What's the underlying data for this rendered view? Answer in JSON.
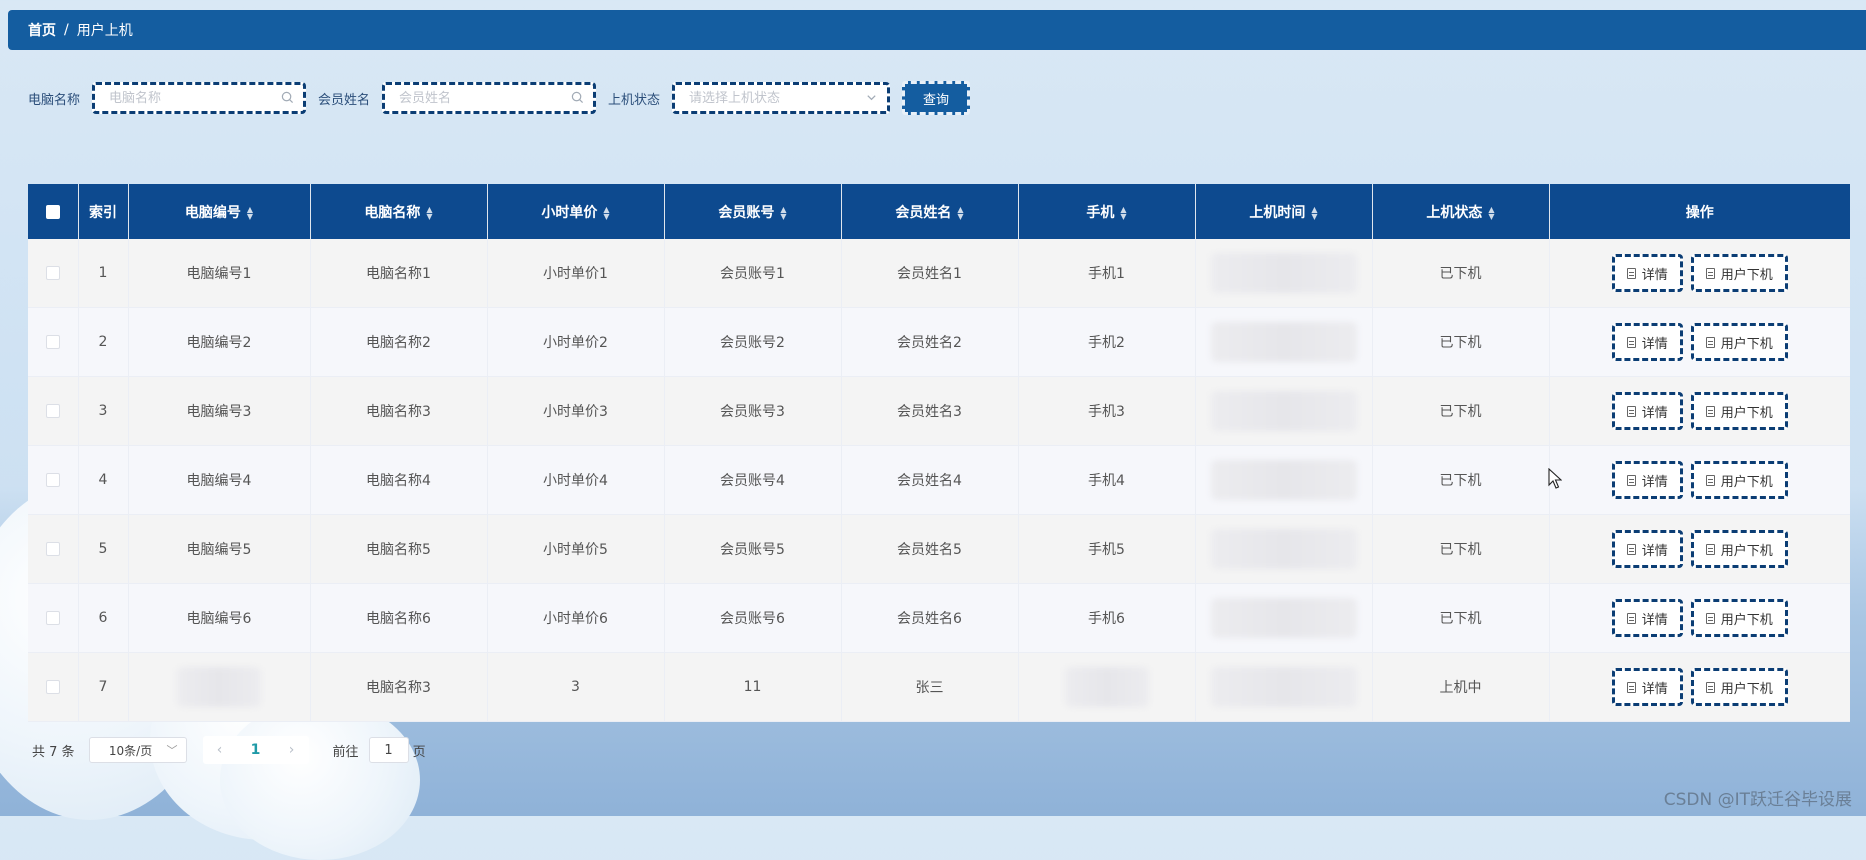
{
  "breadcrumb": {
    "home": "首页",
    "separator": "/",
    "current": "用户上机"
  },
  "search": {
    "computer_name": {
      "label": "电脑名称",
      "placeholder": "电脑名称",
      "value": ""
    },
    "member_name": {
      "label": "会员姓名",
      "placeholder": "会员姓名",
      "value": ""
    },
    "status": {
      "label": "上机状态",
      "placeholder": "请选择上机状态",
      "value": ""
    },
    "query_label": "查询"
  },
  "table": {
    "columns": [
      "索引",
      "电脑编号",
      "电脑名称",
      "小时单价",
      "会员账号",
      "会员姓名",
      "手机",
      "上机时间",
      "上机状态",
      "操作"
    ],
    "rows": [
      {
        "index": "1",
        "computer_no": "电脑编号1",
        "computer_name": "电脑名称1",
        "hour_price": "小时单价1",
        "member_account": "会员账号1",
        "member_name": "会员姓名1",
        "phone": "手机1",
        "status": "已下机"
      },
      {
        "index": "2",
        "computer_no": "电脑编号2",
        "computer_name": "电脑名称2",
        "hour_price": "小时单价2",
        "member_account": "会员账号2",
        "member_name": "会员姓名2",
        "phone": "手机2",
        "status": "已下机"
      },
      {
        "index": "3",
        "computer_no": "电脑编号3",
        "computer_name": "电脑名称3",
        "hour_price": "小时单价3",
        "member_account": "会员账号3",
        "member_name": "会员姓名3",
        "phone": "手机3",
        "status": "已下机"
      },
      {
        "index": "4",
        "computer_no": "电脑编号4",
        "computer_name": "电脑名称4",
        "hour_price": "小时单价4",
        "member_account": "会员账号4",
        "member_name": "会员姓名4",
        "phone": "手机4",
        "status": "已下机"
      },
      {
        "index": "5",
        "computer_no": "电脑编号5",
        "computer_name": "电脑名称5",
        "hour_price": "小时单价5",
        "member_account": "会员账号5",
        "member_name": "会员姓名5",
        "phone": "手机5",
        "status": "已下机"
      },
      {
        "index": "6",
        "computer_no": "电脑编号6",
        "computer_name": "电脑名称6",
        "hour_price": "小时单价6",
        "member_account": "会员账号6",
        "member_name": "会员姓名6",
        "phone": "手机6",
        "status": "已下机"
      },
      {
        "index": "7",
        "computer_no": "",
        "computer_name": "电脑名称3",
        "hour_price": "3",
        "member_account": "11",
        "member_name": "张三",
        "phone": "",
        "status": "上机中"
      }
    ],
    "actions": {
      "detail": "详情",
      "logout": "用户下机"
    }
  },
  "pagination": {
    "total_text": "共 7 条",
    "page_size": "10条/页",
    "current_page": "1",
    "goto_prefix": "前往",
    "goto_value": "1",
    "goto_suffix": "页"
  },
  "watermark": "CSDN @IT跃迁谷毕设展",
  "colors": {
    "header_bar": "#145da0",
    "table_header": "#0d4a8f",
    "button_border": "#0b3d74",
    "page_current": "#1f9aa7"
  }
}
